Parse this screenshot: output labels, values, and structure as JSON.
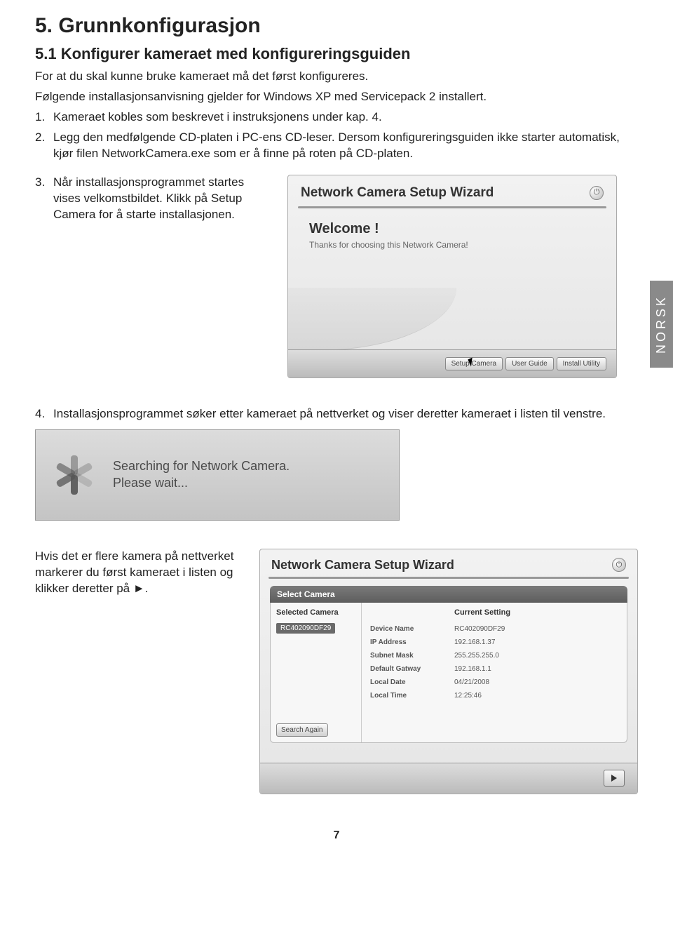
{
  "side_tab": "NORSK",
  "h1": "5. Grunnkonfigurasjon",
  "h2": "5.1 Konfigurer kameraet med konfigureringsguiden",
  "intro1": "For at du skal kunne bruke kameraet må det først konfigureres.",
  "intro2": "Følgende installasjonsanvisning gjelder for Windows XP med Servicepack 2 installert.",
  "steps": {
    "n1": "1.",
    "t1": "Kameraet kobles som beskrevet i instruksjonens under kap. 4.",
    "n2": "2.",
    "t2": "Legg den medfølgende CD-platen i PC-ens CD-leser. Dersom konfigureringsguiden ikke starter automatisk, kjør filen NetworkCamera.exe som er å finne på roten på CD-platen.",
    "n3": "3.",
    "t3": "Når installasjonsprogrammet startes vises velkomstbildet. Klikk på Setup Camera for å starte installasjonen.",
    "n4": "4.",
    "t4": "Installasjonsprogrammet søker etter kameraet på nettverket og viser deretter kameraet i listen til venstre.",
    "t5": "Hvis det er flere kamera på nettverket markerer du først kameraet i listen og klikker deretter på ►."
  },
  "wizard1": {
    "title": "Network Camera Setup Wizard",
    "welcome": "Welcome !",
    "thanks": "Thanks for choosing this Network Camera!",
    "btn_setup": "Setup Camera",
    "btn_guide": "User Guide",
    "btn_install": "Install Utility"
  },
  "search": {
    "line1": "Searching for Network Camera.",
    "line2": "Please wait..."
  },
  "wizard2": {
    "title": "Network Camera Setup Wizard",
    "select_camera": "Select Camera",
    "col_selected": "Selected Camera",
    "col_setting": "Current Setting",
    "camera_id": "RC402090DF29",
    "search_again": "Search Again",
    "rows": [
      {
        "k": "Device Name",
        "v": "RC402090DF29"
      },
      {
        "k": "IP Address",
        "v": "192.168.1.37"
      },
      {
        "k": "Subnet Mask",
        "v": "255.255.255.0"
      },
      {
        "k": "Default Gatway",
        "v": "192.168.1.1"
      },
      {
        "k": "Local Date",
        "v": "04/21/2008"
      },
      {
        "k": "Local Time",
        "v": "12:25:46"
      }
    ]
  },
  "page_number": "7"
}
